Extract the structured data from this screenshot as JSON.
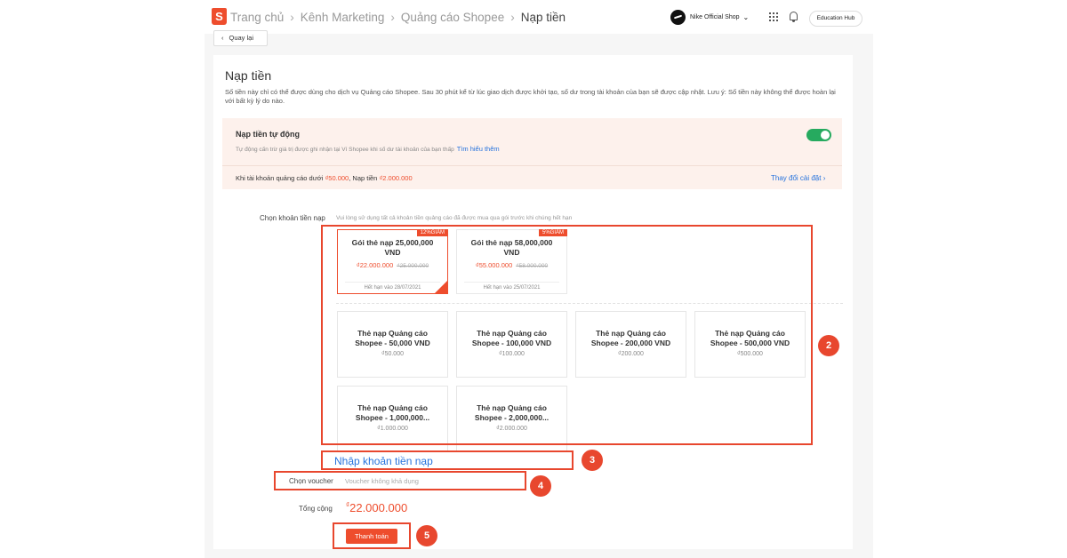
{
  "breadcrumb": {
    "home": "Trang chủ",
    "marketing": "Kênh Marketing",
    "ads": "Quảng cáo Shopee",
    "current": "Nạp tiền"
  },
  "header": {
    "shop_name": "Nike Official Shop",
    "education_hub": "Education Hub"
  },
  "back_label": "Quay lại",
  "page": {
    "title": "Nạp tiền",
    "description": "Số tiền này chỉ có thể được dùng cho dịch vụ Quảng cáo Shopee. Sau 30 phút kể từ lúc giao dịch được khởi tạo, số dư trong tài khoản của bạn sẽ được cập nhật. Lưu ý: Số tiền này không thể được hoàn lại với bất kỳ lý do nào."
  },
  "auto_topup": {
    "title": "Nạp tiền tự động",
    "subtitle": "Tự động cấn trừ giá trị được ghi nhận tại Ví Shopee khi số dư tài khoản của bạn thấp",
    "learn_more": "Tìm hiểu thêm",
    "enabled": true,
    "condition_prefix": "Khi tài khoản quảng cáo dưới",
    "threshold": "₫50.000",
    "condition_mid": ", Nạp tiền",
    "amount": "₫2.000.000",
    "change_settings": "Thay đổi cài đặt"
  },
  "topup": {
    "label": "Chọn khoản tiền nạp",
    "hint": "Vui lòng sử dụng tất cả khoản tiền quảng cáo đã được mua qua gói trước khi chúng hết hạn",
    "packages": [
      {
        "name": "Gói thẻ nạp 25,000,000 VND",
        "discount": "12%GIẢM",
        "price": "₫22.000.000",
        "original": "₫25.000.000",
        "expiry": "Hết hạn vào 28/07/2021",
        "selected": true
      },
      {
        "name": "Gói thẻ nạp 58,000,000 VND",
        "discount": "5%GIẢM",
        "price": "₫55.000.000",
        "original": "₫58.000.000",
        "expiry": "Hết hạn vào 25/07/2021",
        "selected": false
      }
    ],
    "cards": [
      {
        "name": "Thẻ nạp Quảng cáo Shopee - 50,000 VND",
        "value": "₫50.000"
      },
      {
        "name": "Thẻ nạp Quảng cáo Shopee - 100,000 VND",
        "value": "₫100.000"
      },
      {
        "name": "Thẻ nạp Quảng cáo Shopee - 200,000 VND",
        "value": "₫200.000"
      },
      {
        "name": "Thẻ nạp Quảng cáo Shopee - 500,000 VND",
        "value": "₫500.000"
      },
      {
        "name": "Thẻ nạp Quảng cáo Shopee - 1,000,000...",
        "value": "₫1.000.000"
      },
      {
        "name": "Thẻ nạp Quảng cáo Shopee - 2,000,000...",
        "value": "₫2.000.000"
      }
    ],
    "enter_amount": "Nhập khoản tiền nạp"
  },
  "voucher": {
    "label": "Chọn voucher",
    "placeholder": "Voucher không khả dụng"
  },
  "total": {
    "label": "Tổng cộng",
    "currency": "₫",
    "value": "22.000.000"
  },
  "pay_label": "Thanh toán",
  "callouts": [
    "2",
    "3",
    "4",
    "5"
  ],
  "colors": {
    "brand": "#ee4d2d",
    "link": "#2673dd",
    "toggle_on": "#26aa5f",
    "callout": "#e8472e"
  }
}
